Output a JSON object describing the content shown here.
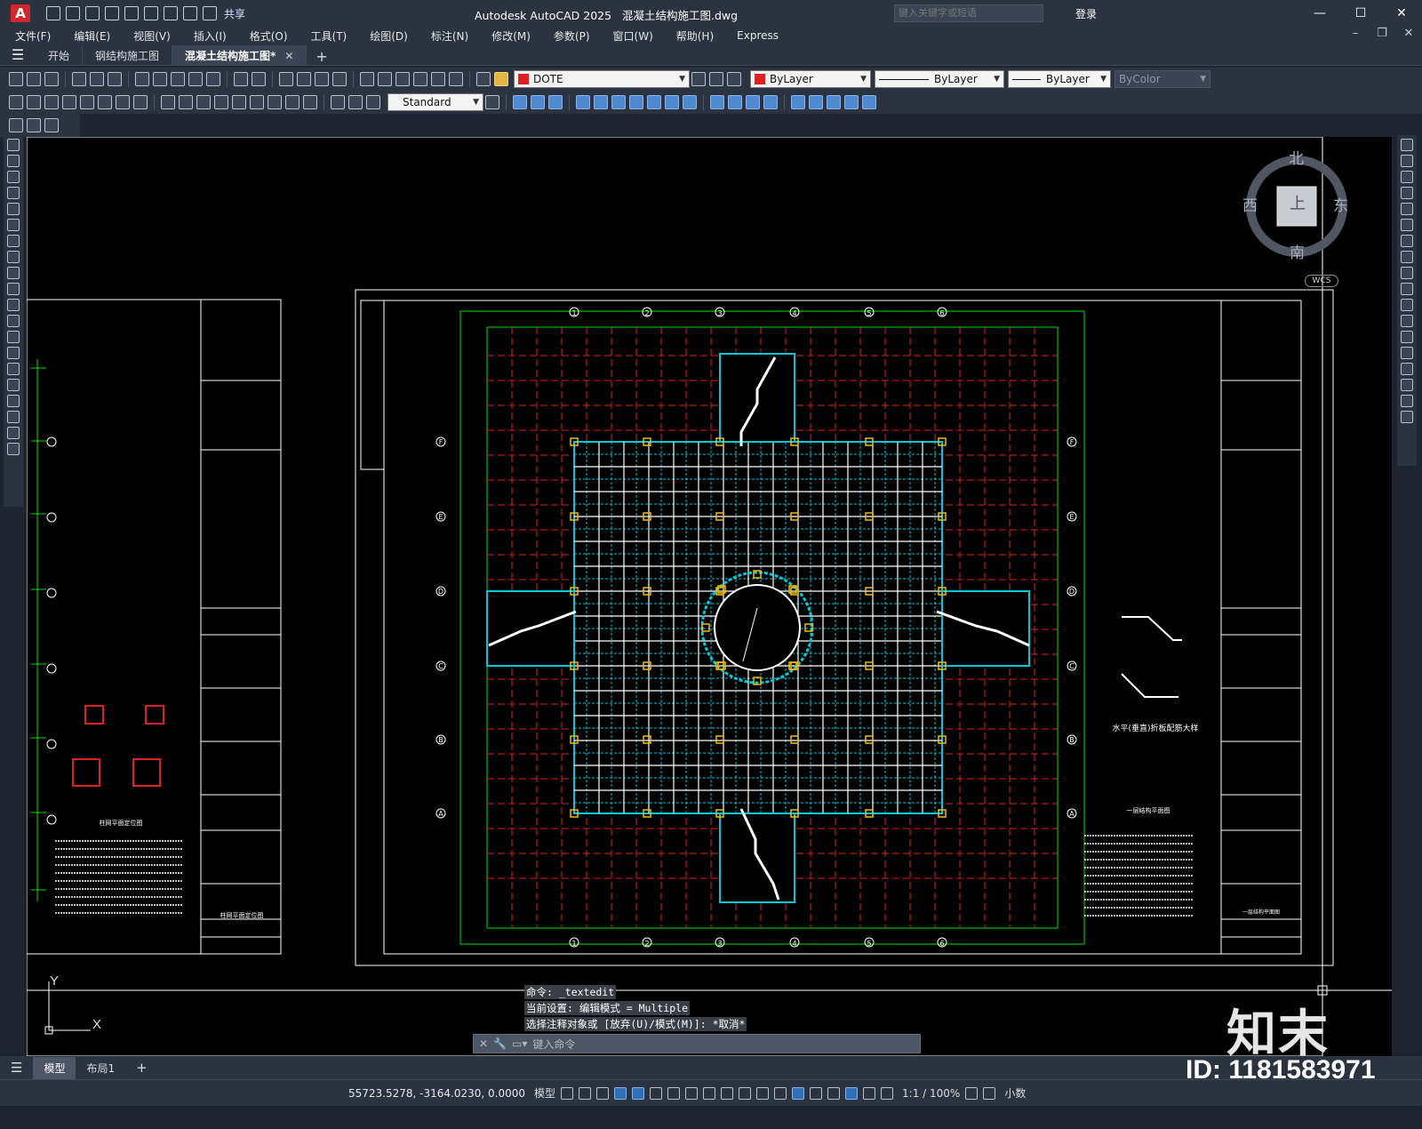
{
  "app": {
    "name": "Autodesk AutoCAD 2025",
    "file": "混凝土结构施工图.dwg",
    "logo": "A",
    "share": "共享",
    "search_placeholder": "键入关键字或短语",
    "login": "登录"
  },
  "menu": [
    "文件(F)",
    "编辑(E)",
    "视图(V)",
    "插入(I)",
    "格式(O)",
    "工具(T)",
    "绘图(D)",
    "标注(N)",
    "修改(M)",
    "参数(P)",
    "窗口(W)",
    "帮助(H)",
    "Express"
  ],
  "tabs": [
    {
      "label": "开始",
      "active": false
    },
    {
      "label": "钢结构施工图",
      "active": false
    },
    {
      "label": "混凝土结构施工图*",
      "active": true
    }
  ],
  "toolbar": {
    "layer": "DOTE",
    "layer_color": "#e02020",
    "text_style": "Standard",
    "color": "ByLayer",
    "color_swatch": "#e02020",
    "linetype": "ByLayer",
    "lineweight": "ByLayer",
    "plotstyle": "ByColor"
  },
  "viewcube": {
    "north": "北",
    "south": "南",
    "east": "东",
    "west": "西",
    "top": "上",
    "wcs": "WCS"
  },
  "ucs": {
    "x": "X",
    "y": "Y"
  },
  "command": {
    "history": [
      "命令: _textedit",
      "当前设置: 编辑模式 = Multiple",
      "选择注释对象或 [放弃(U)/模式(M)]: *取消*"
    ],
    "placeholder": "键入命令"
  },
  "layout_tabs": [
    {
      "label": "模型",
      "active": true
    },
    {
      "label": "布局1",
      "active": false
    }
  ],
  "status": {
    "coords": "55723.5278, -3164.0230, 0.0000",
    "mode": "模型",
    "scale": "1:1 / 100%",
    "units": "小数"
  },
  "drawing": {
    "grid_numbers": [
      "1",
      "2",
      "3",
      "4",
      "5",
      "6"
    ],
    "grid_letters": [
      "F",
      "E",
      "D",
      "C",
      "B",
      "A"
    ],
    "left_title": "柱网平面定位图",
    "detail_title": "水平(垂直)折板配筋大样",
    "plan_title": "一层结构平面图",
    "right_title": "一层结构平面图"
  },
  "watermark": {
    "logo": "知末",
    "id": "ID: 1181583971"
  }
}
